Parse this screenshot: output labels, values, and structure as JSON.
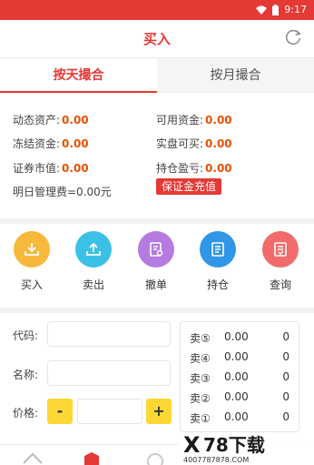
{
  "status_bar": {
    "time": "9:17",
    "wifi_icon": "wifi-icon",
    "battery_icon": "battery-icon"
  },
  "header": {
    "title": "买入",
    "refresh_icon": "refresh-icon"
  },
  "tabs": [
    {
      "label": "按天撮合",
      "active": true
    },
    {
      "label": "按月撮合",
      "active": false
    }
  ],
  "account": {
    "dynamic_assets_label": "动态资产:",
    "dynamic_assets_value": "0.00",
    "available_funds_label": "可用资金:",
    "available_funds_value": "0.00",
    "frozen_funds_label": "冻结资金:",
    "frozen_funds_value": "0.00",
    "buyable_label": "实盘可买:",
    "buyable_value": "0.00",
    "market_value_label": "证券市值:",
    "market_value_value": "0.00",
    "position_pnl_label": "持仓盈亏:",
    "position_pnl_value": "0.00",
    "management_fee": "明日管理费=0.00元",
    "deposit_button": "保证金充值"
  },
  "actions": [
    {
      "label": "买入",
      "icon": "download-tray-icon",
      "color": "#f6b93b"
    },
    {
      "label": "卖出",
      "icon": "upload-tray-icon",
      "color": "#3cc1e6"
    },
    {
      "label": "撤单",
      "icon": "cancel-order-icon",
      "color": "#b57be0"
    },
    {
      "label": "持仓",
      "icon": "position-icon",
      "color": "#2f96e8"
    },
    {
      "label": "查询",
      "icon": "query-icon",
      "color": "#f26b6b"
    }
  ],
  "order_form": {
    "code_label": "代码:",
    "code_value": "",
    "name_label": "名称:",
    "name_value": "",
    "price_label": "价格:",
    "price_value": "",
    "minus_label": "-",
    "plus_label": "+"
  },
  "quotes": [
    {
      "label": "卖⑤",
      "price": "0.00",
      "volume": "0"
    },
    {
      "label": "卖④",
      "price": "0.00",
      "volume": "0"
    },
    {
      "label": "卖③",
      "price": "0.00",
      "volume": "0"
    },
    {
      "label": "卖②",
      "price": "0.00",
      "volume": "0"
    },
    {
      "label": "卖①",
      "price": "0.00",
      "volume": "0"
    }
  ],
  "watermark": {
    "brand": "78下载",
    "url": "4007787878.COM"
  },
  "colors": {
    "accent": "#e53935",
    "value": "#e65100",
    "stepper": "#fdd835"
  }
}
